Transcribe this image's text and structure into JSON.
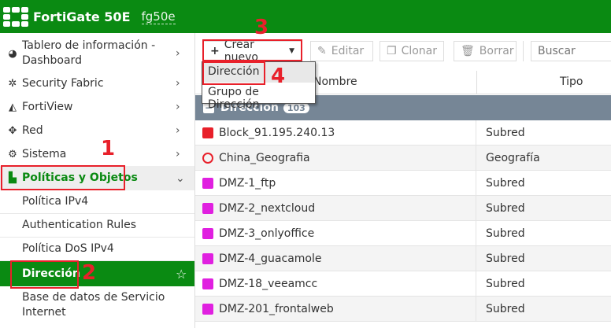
{
  "header": {
    "title": "FortiGate 50E",
    "hostname": "fg50e"
  },
  "sidebar": {
    "items": [
      {
        "label": "Tablero de información - Dashboard",
        "icon": "dashboard-icon"
      },
      {
        "label": "Security Fabric",
        "icon": "security-fabric-icon"
      },
      {
        "label": "FortiView",
        "icon": "chart-icon"
      },
      {
        "label": "Red",
        "icon": "network-icon"
      },
      {
        "label": "Sistema",
        "icon": "gear-icon"
      },
      {
        "label": "Políticas y Objetos",
        "icon": "policy-icon",
        "expanded": true
      }
    ],
    "subitems": [
      {
        "label": "Política IPv4"
      },
      {
        "label": "Authentication Rules"
      },
      {
        "label": "Política DoS IPv4"
      },
      {
        "label": "Dirección",
        "active": true
      },
      {
        "label": "Base de datos de Servicio Internet"
      }
    ]
  },
  "toolbar": {
    "create": "Crear nuevo",
    "edit": "Editar",
    "clone": "Clonar",
    "delete": "Borrar",
    "search_placeholder": "Buscar"
  },
  "dropdown": {
    "items": [
      "Dirección",
      "Grupo de Dirección"
    ]
  },
  "table": {
    "columns": [
      "Nombre",
      "Tipo"
    ],
    "group": {
      "label": "Dirección",
      "count": "103"
    },
    "rows": [
      {
        "name": "Block_91.195.240.13",
        "type": "Subred",
        "color": "#e8202a"
      },
      {
        "name": "China_Geografia",
        "type": "Geografía",
        "color": "#e8202a"
      },
      {
        "name": "DMZ-1_ftp",
        "type": "Subred",
        "color": "#e020e0"
      },
      {
        "name": "DMZ-2_nextcloud",
        "type": "Subred",
        "color": "#e020e0"
      },
      {
        "name": "DMZ-3_onlyoffice",
        "type": "Subred",
        "color": "#e020e0"
      },
      {
        "name": "DMZ-4_guacamole",
        "type": "Subred",
        "color": "#e020e0"
      },
      {
        "name": "DMZ-18_veeamcc",
        "type": "Subred",
        "color": "#e020e0"
      },
      {
        "name": "DMZ-201_frontalweb",
        "type": "Subred",
        "color": "#e020e0"
      }
    ]
  },
  "annotations": [
    "1",
    "2",
    "3",
    "4"
  ],
  "colors": {
    "brand": "#0a8a12",
    "annotation": "#e8202a",
    "group_row": "#768696"
  }
}
